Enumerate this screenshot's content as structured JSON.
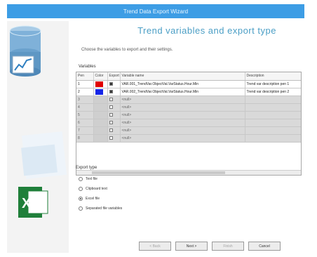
{
  "window": {
    "title": "Trend Data Export Wizard"
  },
  "page": {
    "heading": "Trend variables and export type",
    "instructions": "Choose the variables to export and their settings."
  },
  "grid": {
    "label": "Variables",
    "columns": [
      "Pen",
      "Color",
      "Export",
      "Variable name",
      "Description"
    ],
    "rows": [
      {
        "pen": "1",
        "color": "#e00000",
        "checked": true,
        "variable": "VAR.001_TrendVar.ObjectVal.VarStatus.Hour.Min",
        "description": "Trend var description pen 1"
      },
      {
        "pen": "2",
        "color": "#1626e8",
        "checked": true,
        "variable": "VAR.002_TrendVar.ObjectVal.VarStatus.Hour.Min",
        "description": "Trend var description pen 2"
      },
      {
        "pen": "3",
        "color": "",
        "checked": false,
        "variable": "<null>",
        "description": ""
      },
      {
        "pen": "4",
        "color": "",
        "checked": false,
        "variable": "<null>",
        "description": ""
      },
      {
        "pen": "5",
        "color": "",
        "checked": false,
        "variable": "<null>",
        "description": ""
      },
      {
        "pen": "6",
        "color": "",
        "checked": false,
        "variable": "<null>",
        "description": ""
      },
      {
        "pen": "7",
        "color": "",
        "checked": false,
        "variable": "<null>",
        "description": ""
      },
      {
        "pen": "8",
        "color": "",
        "checked": false,
        "variable": "<null>",
        "description": ""
      }
    ]
  },
  "export_type": {
    "label": "Export type",
    "options": [
      {
        "label": "Text file",
        "selected": false
      },
      {
        "label": "Clipboard text",
        "selected": false
      },
      {
        "label": "Excel file",
        "selected": true
      },
      {
        "label": "Separated file variables",
        "selected": false
      }
    ]
  },
  "buttons": {
    "back": "< Back",
    "next": "Next >",
    "finish": "Finish",
    "cancel": "Cancel"
  },
  "colors": {
    "titlebar": "#3d9de5",
    "heading": "#4a9ec5"
  }
}
